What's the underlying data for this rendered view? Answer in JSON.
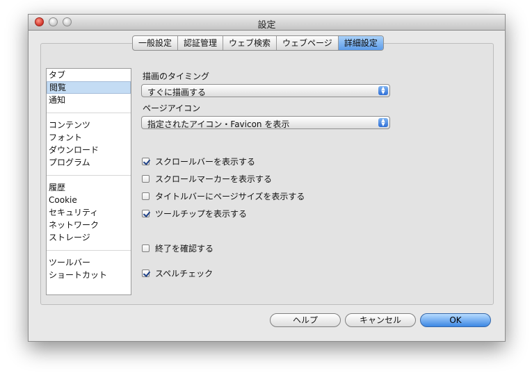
{
  "window": {
    "title": "設定"
  },
  "tabs": [
    {
      "label": "一般設定"
    },
    {
      "label": "認証管理"
    },
    {
      "label": "ウェブ検索"
    },
    {
      "label": "ウェブページ"
    },
    {
      "label": "詳細設定"
    }
  ],
  "sidebar": {
    "groups": [
      [
        "タブ",
        "閲覧",
        "通知"
      ],
      [
        "コンテンツ",
        "フォント",
        "ダウンロード",
        "プログラム"
      ],
      [
        "履歴",
        "Cookie",
        "セキュリティ",
        "ネットワーク",
        "ストレージ"
      ],
      [
        "ツールバー",
        "ショートカット"
      ]
    ],
    "selected": "閲覧"
  },
  "rendering": {
    "label": "描画のタイミング",
    "value": "すぐに描画する"
  },
  "page_icon": {
    "label": "ページアイコン",
    "value": "指定されたアイコン・Favicon を表示"
  },
  "checkboxes": [
    {
      "label": "スクロールバーを表示する",
      "checked": true
    },
    {
      "label": "スクロールマーカーを表示する",
      "checked": false
    },
    {
      "label": "タイトルバーにページサイズを表示する",
      "checked": false
    },
    {
      "label": "ツールチップを表示する",
      "checked": true
    },
    {
      "label": "終了を確認する",
      "checked": false
    },
    {
      "label": "スペルチェック",
      "checked": true
    }
  ],
  "buttons": {
    "help": "ヘルプ",
    "cancel": "キャンセル",
    "ok": "OK"
  }
}
